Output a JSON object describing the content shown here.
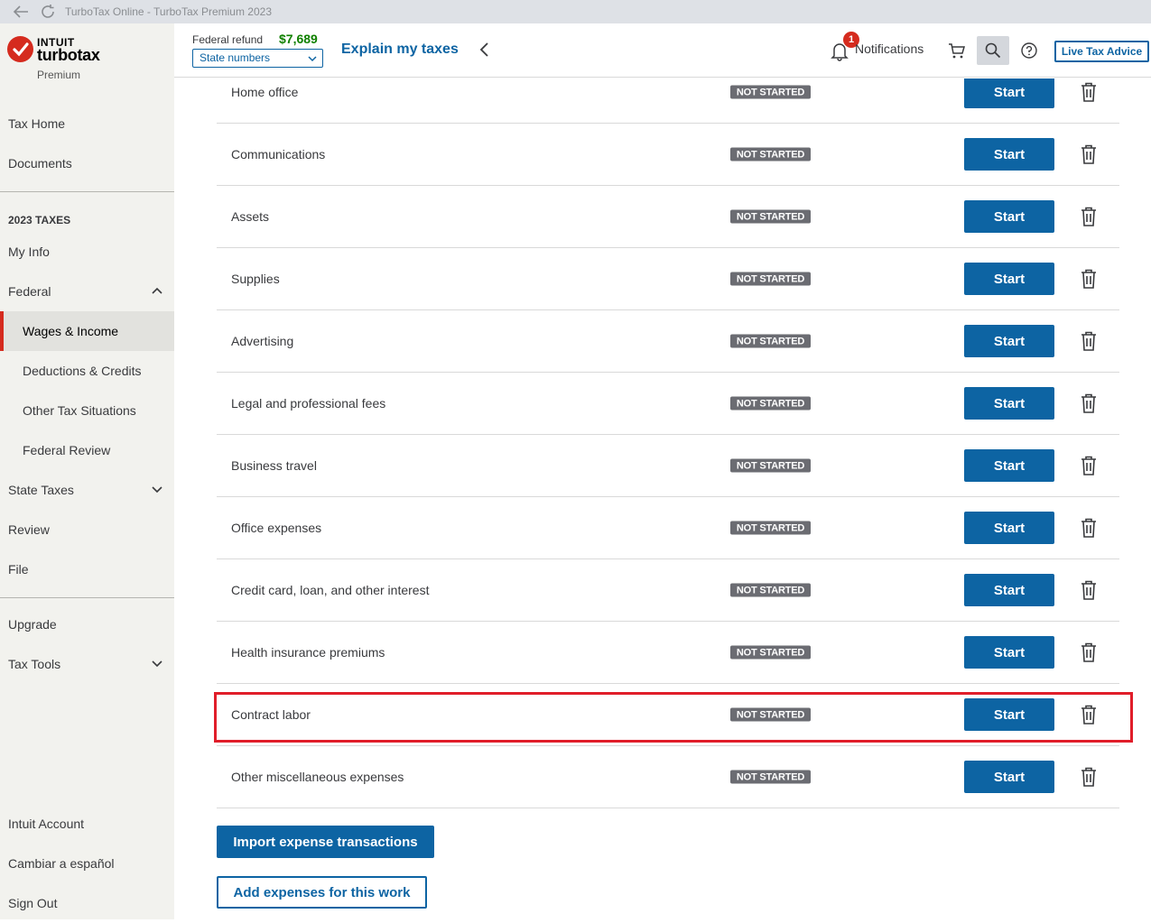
{
  "browser": {
    "title": "TurboTax Online - TurboTax Premium 2023"
  },
  "brand": {
    "intuit": "INTUIT",
    "product": "turbotax",
    "edition": "Premium"
  },
  "sidebar": {
    "tax_home": "Tax Home",
    "documents": "Documents",
    "section_heading": "2023 TAXES",
    "my_info": "My Info",
    "federal": "Federal",
    "federal_subitems": [
      "Wages & Income",
      "Deductions & Credits",
      "Other Tax Situations",
      "Federal Review"
    ],
    "active_item": "Wages & Income",
    "state_taxes": "State Taxes",
    "review": "Review",
    "file": "File",
    "upgrade": "Upgrade",
    "tax_tools": "Tax Tools",
    "intuit_account": "Intuit Account",
    "spanish": "Cambiar a español",
    "sign_out": "Sign Out"
  },
  "header": {
    "refund_label": "Federal refund",
    "refund_amount": "$7,689",
    "state_select": "State numbers",
    "explain": "Explain my taxes",
    "notification_count": "1",
    "notifications": "Notifications",
    "live_advice": "Live Tax Advice"
  },
  "expenses": {
    "status_label": "NOT STARTED",
    "start_label": "Start",
    "rows": [
      "Home office",
      "Communications",
      "Assets",
      "Supplies",
      "Advertising",
      "Legal and professional fees",
      "Business travel",
      "Office expenses",
      "Credit card, loan, and other interest",
      "Health insurance premiums",
      "Contract labor",
      "Other miscellaneous expenses"
    ],
    "highlighted_row": "Contract labor"
  },
  "actions": {
    "import": "Import expense transactions",
    "add": "Add expenses for this work"
  },
  "colors": {
    "primary": "#0d64a3",
    "refund_green": "#108000",
    "brand_red": "#d52b1e",
    "highlight_red": "#e01e2a",
    "status_gray": "#6b6c72"
  }
}
